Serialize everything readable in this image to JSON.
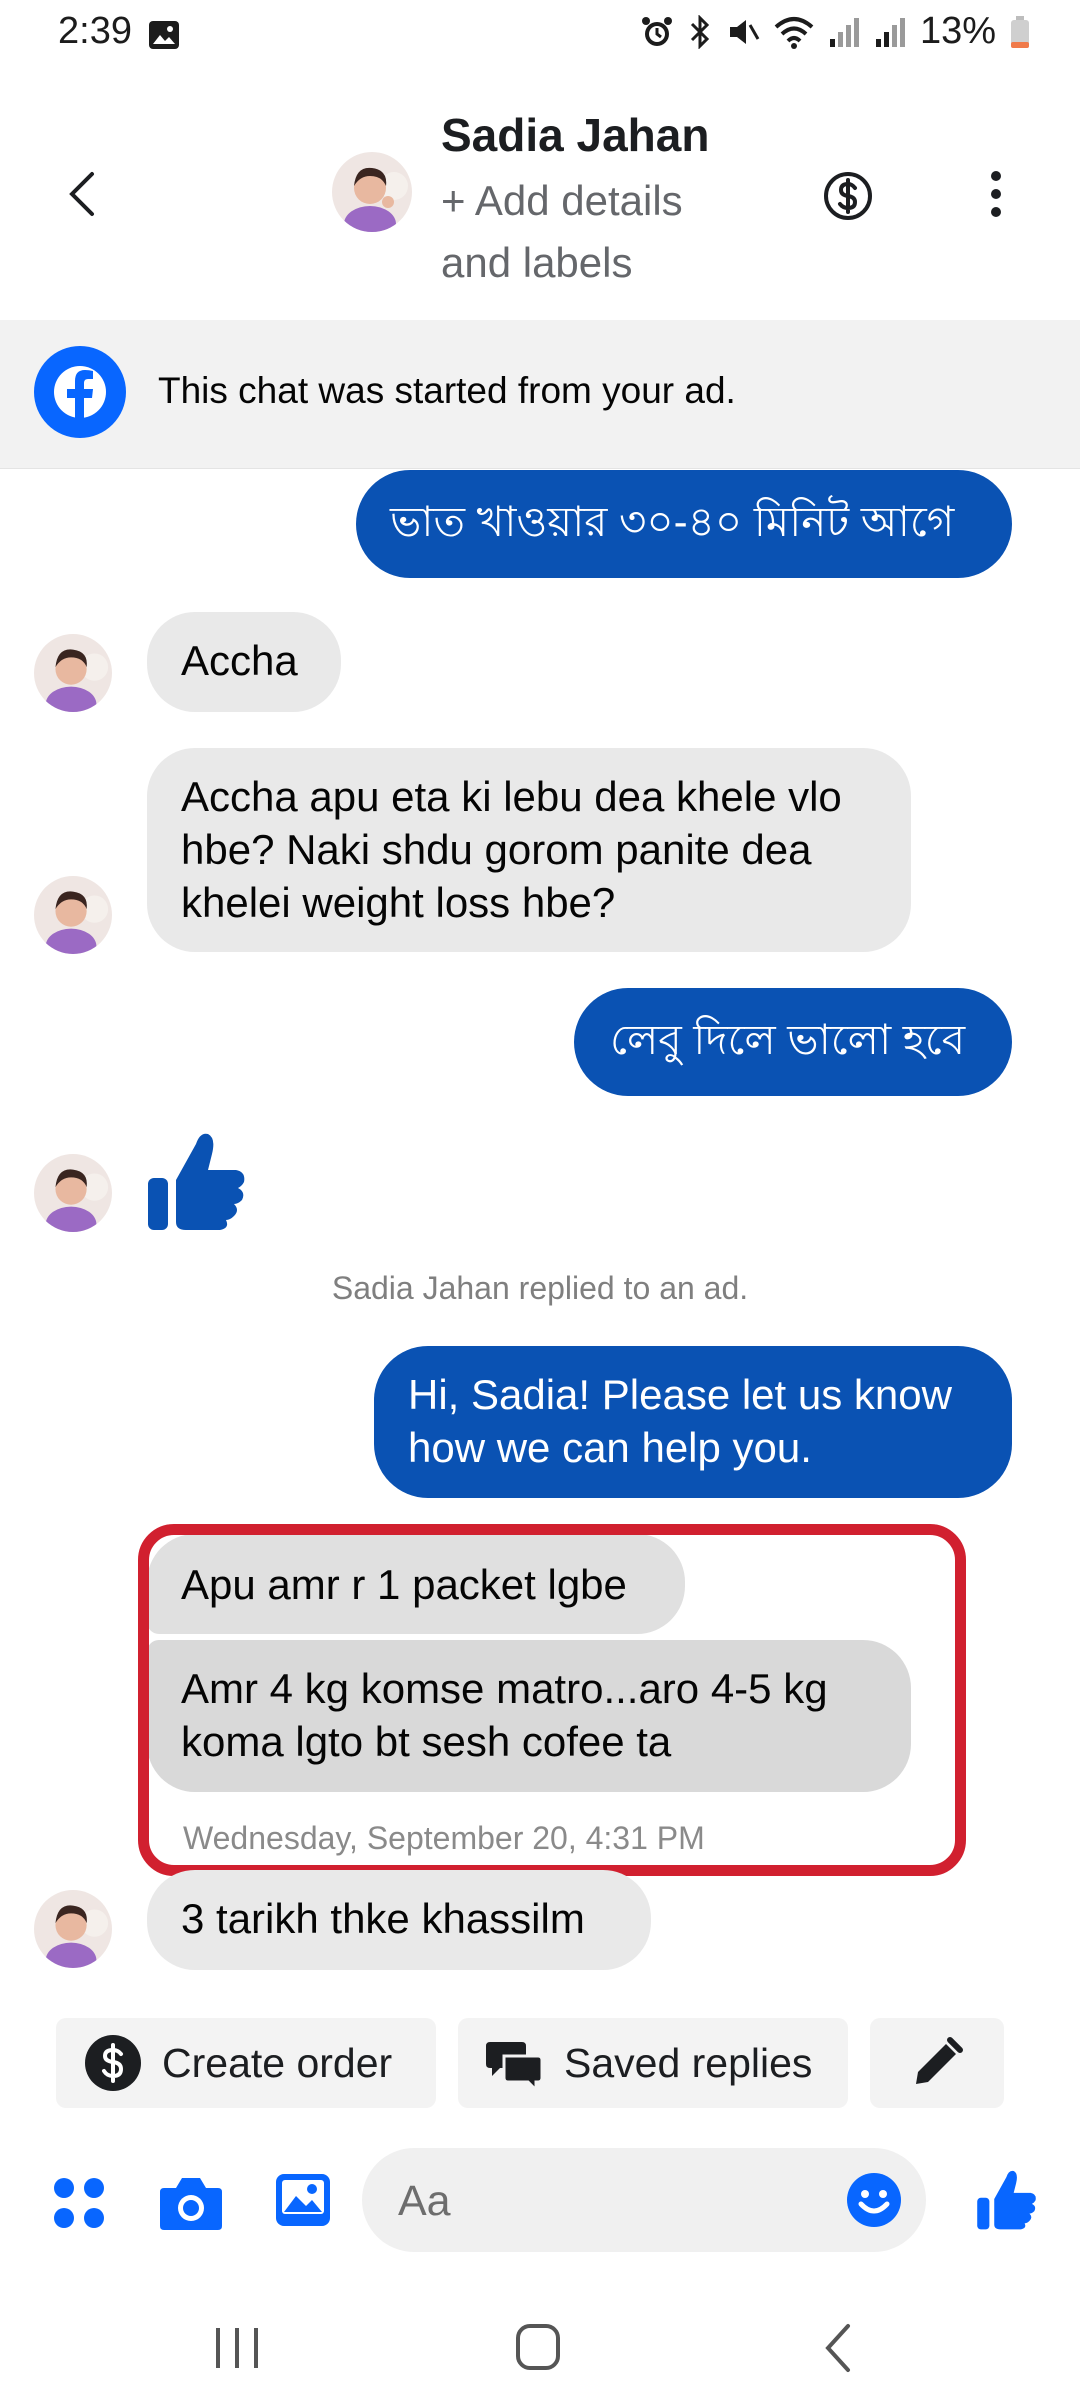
{
  "status": {
    "time": "2:39",
    "battery": "13%"
  },
  "header": {
    "name": "Sadia Jahan",
    "add_details": "+ Add details and labels"
  },
  "banner": {
    "text": "This chat was started from your ad."
  },
  "messages": {
    "m1": "ভাত খাওয়ার ৩০-৪০ মিনিট আগে",
    "m2": "Accha",
    "m3": "Accha apu eta ki lebu dea khele vlo hbe? Naki shdu gorom panite dea khelei weight loss hbe?",
    "m4": "লেবু দিলে ভালো হবে",
    "notice": "Sadia Jahan replied to an ad.",
    "m6": "Hi, Sadia! Please let us know how we can help you.",
    "m7": "Apu amr r 1 packet lgbe",
    "m8": "Amr 4 kg komse matro...aro 4-5 kg koma lgto bt sesh cofee ta",
    "timestamp": "Wednesday, September 20, 4:31 PM",
    "m9": "3 tarikh thke khassilm"
  },
  "quick_actions": {
    "create_order": "Create order",
    "saved_replies": "Saved replies"
  },
  "composer": {
    "placeholder": "Aa"
  },
  "colors": {
    "outgoing_bubble": "#0a52b3",
    "incoming_bubble": "#e9e9e9",
    "accent": "#0866ff",
    "highlight": "#d1202f"
  }
}
